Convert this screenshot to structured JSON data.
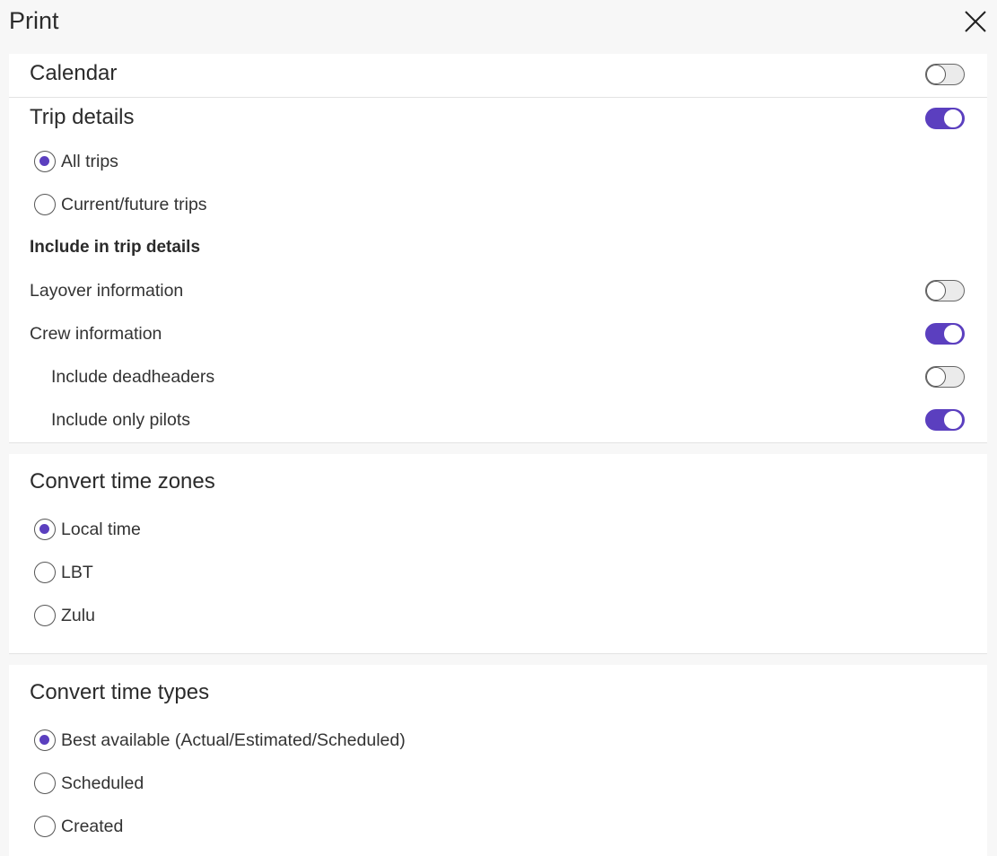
{
  "dialog": {
    "title": "Print",
    "close_icon": "close-icon"
  },
  "calendar": {
    "title": "Calendar",
    "enabled": false
  },
  "trip_details": {
    "title": "Trip details",
    "enabled": true,
    "scope_options": [
      {
        "label": "All trips",
        "selected": true
      },
      {
        "label": "Current/future trips",
        "selected": false
      }
    ],
    "include_heading": "Include in trip details",
    "layover": {
      "label": "Layover information",
      "enabled": false
    },
    "crew": {
      "label": "Crew information",
      "enabled": true
    },
    "deadheaders": {
      "label": "Include deadheaders",
      "enabled": false
    },
    "only_pilots": {
      "label": "Include only pilots",
      "enabled": true
    }
  },
  "time_zones": {
    "title": "Convert time zones",
    "options": [
      {
        "label": "Local time",
        "selected": true
      },
      {
        "label": "LBT",
        "selected": false
      },
      {
        "label": "Zulu",
        "selected": false
      }
    ]
  },
  "time_types": {
    "title": "Convert time types",
    "options": [
      {
        "label": "Best available (Actual/Estimated/Scheduled)",
        "selected": true
      },
      {
        "label": "Scheduled",
        "selected": false
      },
      {
        "label": "Created",
        "selected": false
      }
    ]
  },
  "colors": {
    "accent": "#5b3fbf",
    "background": "#f7f7f7",
    "card": "#ffffff"
  }
}
